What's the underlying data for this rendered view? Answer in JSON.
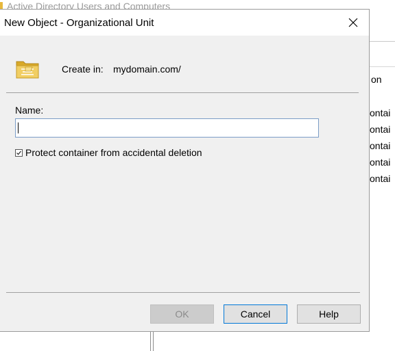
{
  "background_window": {
    "title": "Active Directory Users and Computers",
    "column_header": "on",
    "rows": [
      "ontai",
      "ontai",
      "ontai",
      "ontai",
      "ontai"
    ]
  },
  "dialog": {
    "title": "New Object - Organizational Unit",
    "create_in_label": "Create in:",
    "create_in_value": "mydomain.com/",
    "name_label": "Name:",
    "name_value": "",
    "protect_label": "Protect container from accidental deletion",
    "protect_checked": true,
    "buttons": {
      "ok": "OK",
      "cancel": "Cancel",
      "help": "Help"
    },
    "icons": {
      "close": "close-icon",
      "ou": "organizational-unit-icon",
      "check": "checkmark-icon"
    }
  },
  "colors": {
    "dialog_bg": "#f0f0f0",
    "focus_border": "#0078d7",
    "input_border": "#7a9cc6",
    "ou_folder": "#e7c051"
  }
}
